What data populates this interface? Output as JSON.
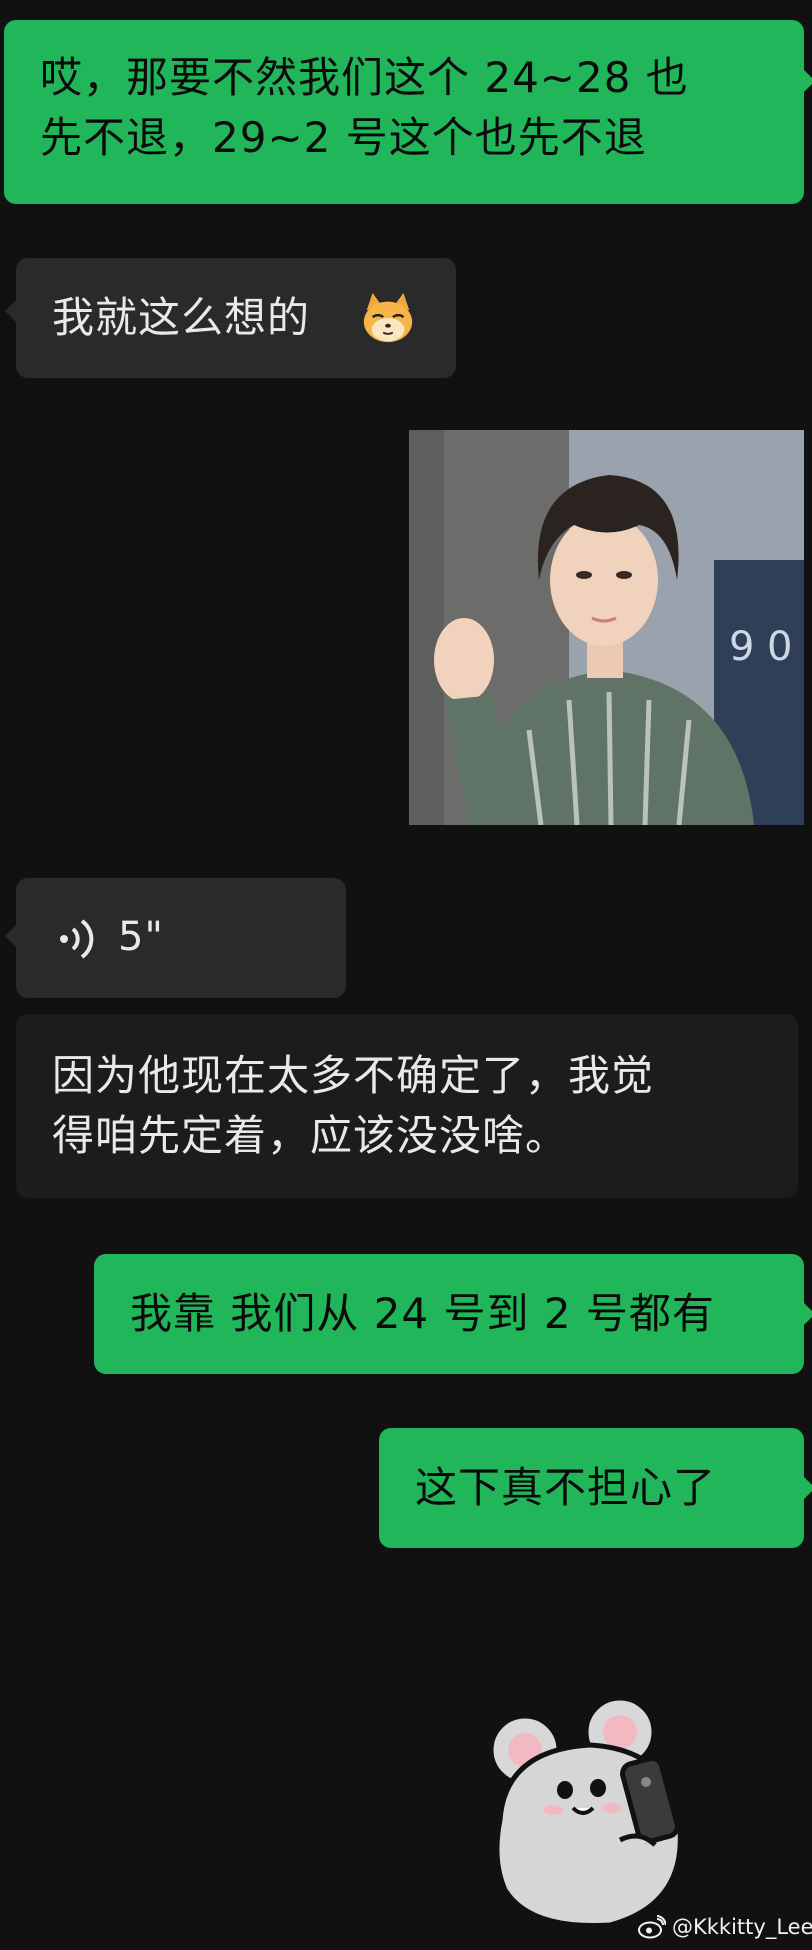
{
  "messages": [
    {
      "side": "right",
      "type": "text",
      "lines": [
        "哎，那要不然我们这个 24~28 也",
        "先不退，29~2 号这个也先不退"
      ]
    },
    {
      "side": "left",
      "type": "text",
      "lines": [
        "我就这么想的"
      ],
      "emoji": "doge-cat-emoji"
    },
    {
      "side": "right",
      "type": "image",
      "description_icon": "photo-of-person-finger-heart"
    },
    {
      "side": "left",
      "type": "voice",
      "duration": "5\""
    },
    {
      "side": "left",
      "type": "transcript",
      "lines": [
        "因为他现在太多不确定了，我觉",
        "得咱先定着，应该没没啥。"
      ]
    },
    {
      "side": "right",
      "type": "text",
      "lines": [
        "我靠 我们从 24 号到 2 号都有"
      ]
    },
    {
      "side": "right",
      "type": "text",
      "lines": [
        "这下真不担心了"
      ]
    },
    {
      "type": "sticker",
      "icon": "mouse-phone-sticker"
    }
  ],
  "watermark": {
    "text": "@Kkkitty_Lee",
    "icon": "weibo-icon"
  },
  "colors": {
    "background": "#111111",
    "outgoing": "#22b65b",
    "incoming": "#2a2a2a"
  }
}
